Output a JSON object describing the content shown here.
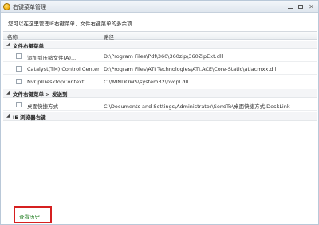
{
  "window": {
    "title": "右键菜单管理",
    "icon": "app-logo-icon"
  },
  "description": "您可以在这里管理IE右键菜单、文件右键菜单的多余项",
  "table": {
    "columns": [
      "名称",
      "路径"
    ]
  },
  "groups": [
    {
      "label": "文件右键菜单",
      "items": [
        {
          "name": "添加到压缩文件(A)...",
          "path": "D:\\Program Files\\Pdf\\360\\360zip\\360ZipExt.dll"
        },
        {
          "name": "Catalyst(TM) Control Center",
          "path": "D:\\Program Files\\ATI Technologies\\ATI.ACE\\Core-Static\\atiacmxx.dll"
        },
        {
          "name": "NvCplDesktopContext",
          "path": "C:\\WINDOWS\\system32\\nvcpl.dll"
        }
      ]
    },
    {
      "label": "文件右键菜单 > 发送到",
      "items": [
        {
          "name": "桌面快捷方式",
          "path": "C:\\Documents and Settings\\Administrator\\SendTo\\桌面快捷方式.DeskLink"
        }
      ]
    },
    {
      "label": "IE 浏览器右键",
      "items": []
    }
  ],
  "footer": {
    "history_label": "查看历史"
  },
  "colors": {
    "highlight_border": "#d62020",
    "history_text": "#1a7a1a"
  }
}
